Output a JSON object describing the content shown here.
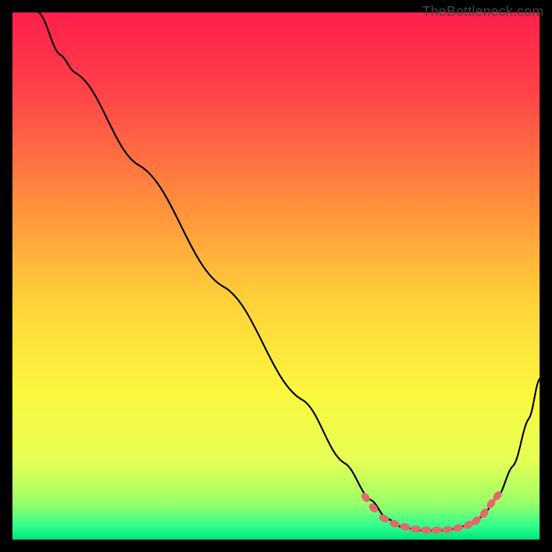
{
  "watermark": "TheBottleneck.com",
  "chart_data": {
    "type": "line",
    "title": "",
    "xlabel": "",
    "ylabel": "",
    "xlim": [
      0,
      100
    ],
    "ylim": [
      0,
      100
    ],
    "background_gradient_stops": [
      {
        "offset": 0.0,
        "color": "#ff1f4b"
      },
      {
        "offset": 0.15,
        "color": "#ff4249"
      },
      {
        "offset": 0.35,
        "color": "#ff8a3d"
      },
      {
        "offset": 0.55,
        "color": "#ffd23a"
      },
      {
        "offset": 0.72,
        "color": "#fbf73e"
      },
      {
        "offset": 0.85,
        "color": "#e7ff55"
      },
      {
        "offset": 0.93,
        "color": "#9cff68"
      },
      {
        "offset": 0.975,
        "color": "#2fff8e"
      },
      {
        "offset": 1.0,
        "color": "#00e27a"
      }
    ],
    "curve": [
      {
        "x": 5.0,
        "y": 100.0
      },
      {
        "x": 9.0,
        "y": 92.0
      },
      {
        "x": 12.0,
        "y": 88.5
      },
      {
        "x": 24.0,
        "y": 71.0
      },
      {
        "x": 40.0,
        "y": 48.0
      },
      {
        "x": 55.0,
        "y": 26.5
      },
      {
        "x": 63.0,
        "y": 14.5
      },
      {
        "x": 68.0,
        "y": 7.5
      },
      {
        "x": 71.0,
        "y": 4.0
      },
      {
        "x": 74.0,
        "y": 2.3
      },
      {
        "x": 78.0,
        "y": 1.7
      },
      {
        "x": 82.0,
        "y": 1.7
      },
      {
        "x": 86.0,
        "y": 2.6
      },
      {
        "x": 89.0,
        "y": 4.3
      },
      {
        "x": 92.0,
        "y": 8.0
      },
      {
        "x": 95.0,
        "y": 14.0
      },
      {
        "x": 98.0,
        "y": 23.0
      },
      {
        "x": 100.0,
        "y": 30.5
      }
    ],
    "dotted_segments": [
      {
        "x": 67.0,
        "y": 8.0
      },
      {
        "x": 68.5,
        "y": 6.0
      },
      {
        "x": 70.5,
        "y": 4.0
      },
      {
        "x": 72.5,
        "y": 3.0
      },
      {
        "x": 74.5,
        "y": 2.4
      },
      {
        "x": 76.5,
        "y": 2.0
      },
      {
        "x": 78.5,
        "y": 1.8
      },
      {
        "x": 80.5,
        "y": 1.8
      },
      {
        "x": 82.5,
        "y": 1.9
      },
      {
        "x": 84.5,
        "y": 2.2
      },
      {
        "x": 86.5,
        "y": 2.8
      },
      {
        "x": 88.0,
        "y": 3.6
      },
      {
        "x": 89.5,
        "y": 5.0
      },
      {
        "x": 90.8,
        "y": 6.8
      },
      {
        "x": 92.0,
        "y": 8.3
      }
    ],
    "dot_color": "#e26a6a",
    "curve_color": "#000000",
    "curve_width": 2.4,
    "dot_rx": 5.2,
    "dot_ry": 7.4
  }
}
